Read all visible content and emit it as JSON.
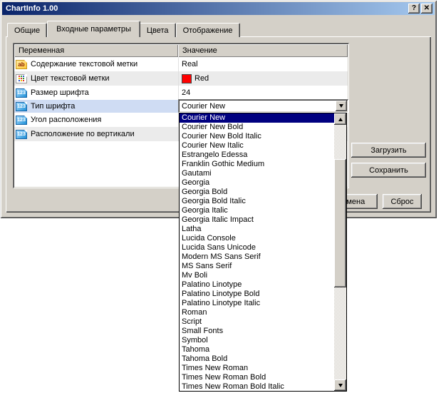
{
  "window": {
    "title": "ChartInfo 1.00"
  },
  "icons": {
    "help": "?",
    "close": "✕",
    "text_label": "ab",
    "numeric": "123",
    "combo_arrow": "combo-arrow-down",
    "scroll_up": "scroll-arrow-up",
    "scroll_down": "scroll-arrow-down"
  },
  "tabs": [
    {
      "label": "Общие",
      "active": false
    },
    {
      "label": "Входные параметры",
      "active": true
    },
    {
      "label": "Цвета",
      "active": false
    },
    {
      "label": "Отображение",
      "active": false
    }
  ],
  "table": {
    "columns": [
      "Переменная",
      "Значение"
    ],
    "rows": [
      {
        "icon": "text",
        "name": "Содержание текстовой метки",
        "value": "Real"
      },
      {
        "icon": "color",
        "name": "Цвет текстовой метки",
        "value": "Red",
        "swatch": "#ff0000"
      },
      {
        "icon": "number",
        "name": "Размер шрифта",
        "value": "24"
      },
      {
        "icon": "number",
        "name": "Тип шрифта",
        "value": "Courier New",
        "selected": true,
        "editor": "combobox"
      },
      {
        "icon": "number",
        "name": "Угол расположения",
        "value": ""
      },
      {
        "icon": "number",
        "name": "Расположение по вертикали",
        "value": ""
      }
    ]
  },
  "buttons": {
    "load": "Загрузить",
    "save": "Сохранить",
    "cancel": "Отмена",
    "reset": "Сброс"
  },
  "dropdown": {
    "selected": "Courier New",
    "items": [
      "Courier New",
      "Courier New Bold",
      "Courier New Bold Italic",
      "Courier New Italic",
      "Estrangelo Edessa",
      "Franklin Gothic Medium",
      "Gautami",
      "Georgia",
      "Georgia Bold",
      "Georgia Bold Italic",
      "Georgia Italic",
      "Georgia Italic Impact",
      "Latha",
      "Lucida Console",
      "Lucida Sans Unicode",
      "Modern MS Sans Serif",
      "MS Sans Serif",
      "Mv Boli",
      "Palatino Linotype",
      "Palatino Linotype Bold",
      "Palatino Linotype Italic",
      "Roman",
      "Script",
      "Small Fonts",
      "Symbol",
      "Tahoma",
      "Tahoma Bold",
      "Times New Roman",
      "Times New Roman Bold",
      "Times New Roman Bold Italic"
    ]
  },
  "colors": {
    "titlebar_left": "#0a246a",
    "titlebar_right": "#a6caf0",
    "dialog_bg": "#d4d0c8",
    "selection_bg": "#000080",
    "selected_row_bg": "#cfdcf3",
    "alt_row_bg": "#ebebeb",
    "swatch_red": "#ff0000"
  }
}
